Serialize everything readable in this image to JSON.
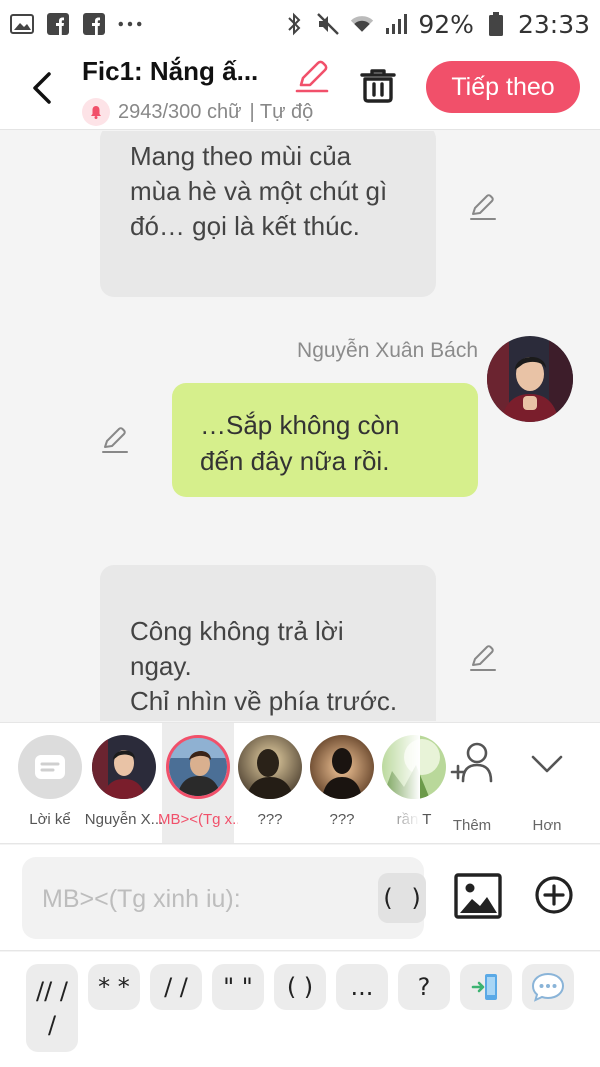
{
  "status_bar": {
    "battery": "92%",
    "time": "23:33",
    "left_icons": [
      "image-icon",
      "facebook-icon",
      "facebook-icon",
      "more-icon"
    ],
    "right_icons": [
      "bluetooth-icon",
      "mute-icon",
      "wifi-icon",
      "signal-icon",
      "battery-icon"
    ]
  },
  "header": {
    "title": "Fic1: Nắng ấ...",
    "word_count": "2943/300 chữ",
    "mode": "| Tự độ",
    "next_label": "Tiếp theo",
    "accent_color": "#f1506a"
  },
  "chat": {
    "messages": [
      {
        "side": "left",
        "text": "Mang theo mùi của mùa hè và một chút gì đó… gọi là kết thúc."
      },
      {
        "side": "right",
        "sender": "Nguyễn Xuân Bách",
        "text": "…Sắp không còn đến đây nữa rồi."
      },
      {
        "side": "left",
        "text": "Công không trả lời ngay.\nChỉ nhìn về phía trước."
      }
    ],
    "right_bubble_color": "#d6ef8c",
    "left_bubble_color": "#e8e8e8"
  },
  "characters": [
    {
      "label": "Lời kể"
    },
    {
      "label": "Nguyễn X..."
    },
    {
      "label": "MB><(Tg x...",
      "selected": true
    },
    {
      "label": "???"
    },
    {
      "label": "???"
    },
    {
      "label": "rần T"
    }
  ],
  "tools": {
    "add_label": "Thêm",
    "more_label": "Hơn"
  },
  "composer": {
    "placeholder": "MB><(Tg xinh iu):",
    "paren_label": "( )"
  },
  "symbol_keys": [
    "// /\n/",
    "* *",
    "/ /",
    "\" \"",
    "( )",
    "...",
    "?",
    "phone-icon",
    "chat-icon"
  ]
}
